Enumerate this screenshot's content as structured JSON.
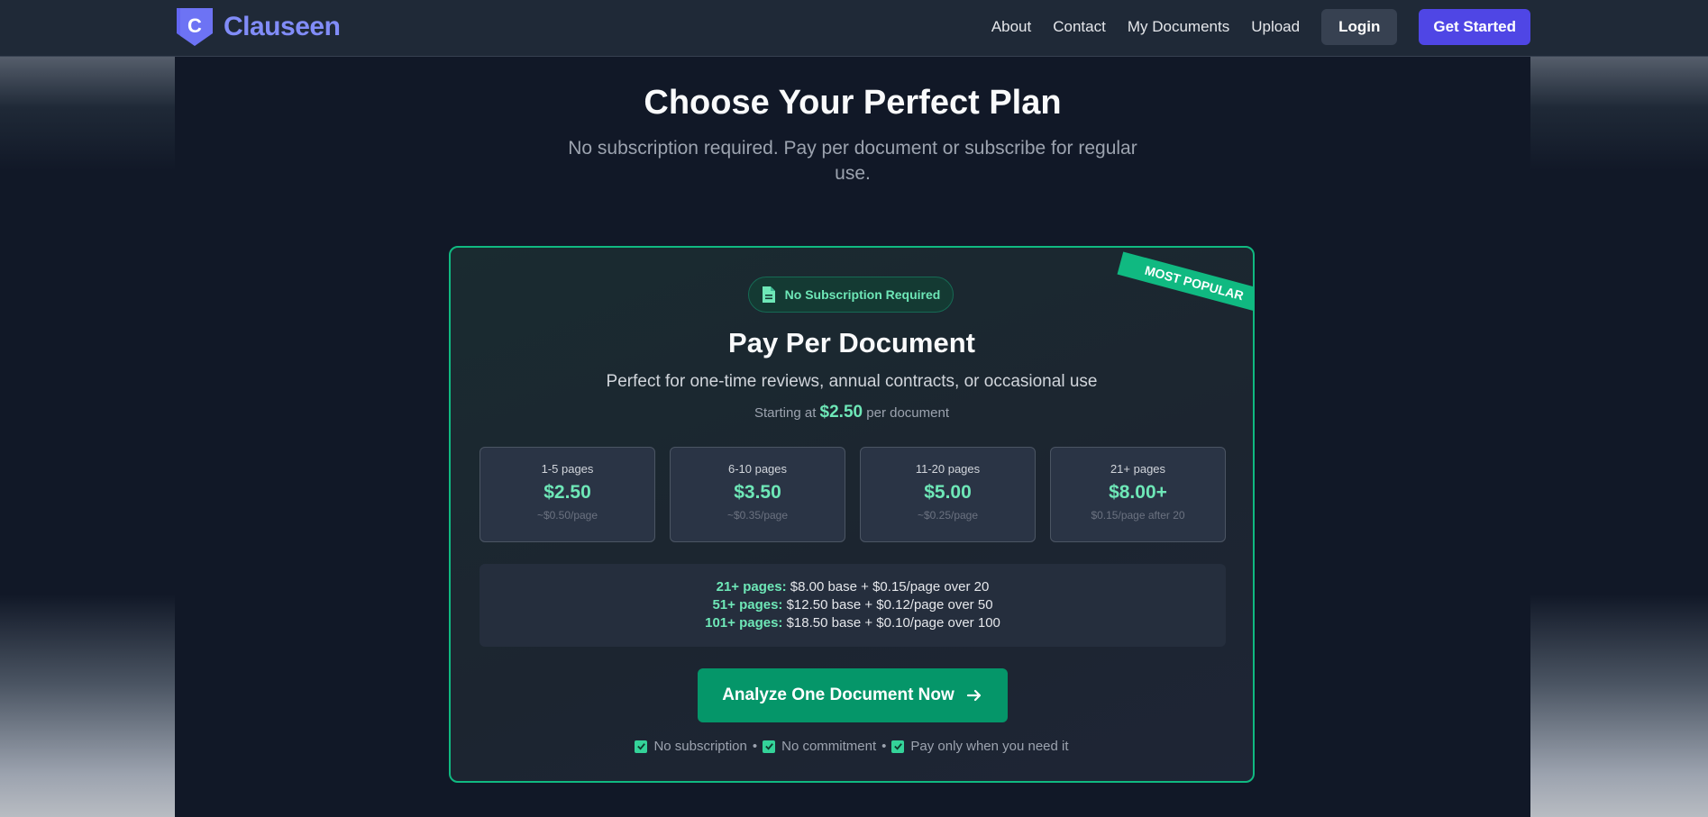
{
  "nav": {
    "logo_letter": "C",
    "brand": "Clauseen",
    "links": [
      "About",
      "Contact",
      "My Documents",
      "Upload"
    ],
    "login": "Login",
    "get_started": "Get Started"
  },
  "hero": {
    "title": "Choose Your Perfect Plan",
    "subtitle": "No subscription required. Pay per document or subscribe for regular use."
  },
  "plan": {
    "ribbon": "MOST POPULAR",
    "badge": "No Subscription Required",
    "badge_icon": "document-icon",
    "name": "Pay Per Document",
    "description": "Perfect for one-time reviews, annual contracts, or occasional use",
    "starting_prefix": "Starting at",
    "starting_price": "$2.50",
    "starting_suffix": "per document",
    "tiers": [
      {
        "range": "1-5 pages",
        "price": "$2.50",
        "per_page": "~$0.50/page"
      },
      {
        "range": "6-10 pages",
        "price": "$3.50",
        "per_page": "~$0.35/page"
      },
      {
        "range": "11-20 pages",
        "price": "$5.00",
        "per_page": "~$0.25/page"
      },
      {
        "range": "21+ pages",
        "price": "$8.00+",
        "per_page": "$0.15/page after 20"
      }
    ],
    "details": [
      {
        "label": "21+ pages:",
        "text": "$8.00 base + $0.15/page over 20"
      },
      {
        "label": "51+ pages:",
        "text": "$12.50 base + $0.12/page over 50"
      },
      {
        "label": "101+ pages:",
        "text": "$18.50 base + $0.10/page over 100"
      }
    ],
    "cta": "Analyze One Document Now",
    "benefits": [
      "No subscription",
      "No commitment",
      "Pay only when you need it"
    ],
    "separator": "•"
  },
  "colors": {
    "brand": "#818cf8",
    "accent_green": "#10b981",
    "cta_green": "#059669",
    "primary_button": "#4f46e5"
  }
}
